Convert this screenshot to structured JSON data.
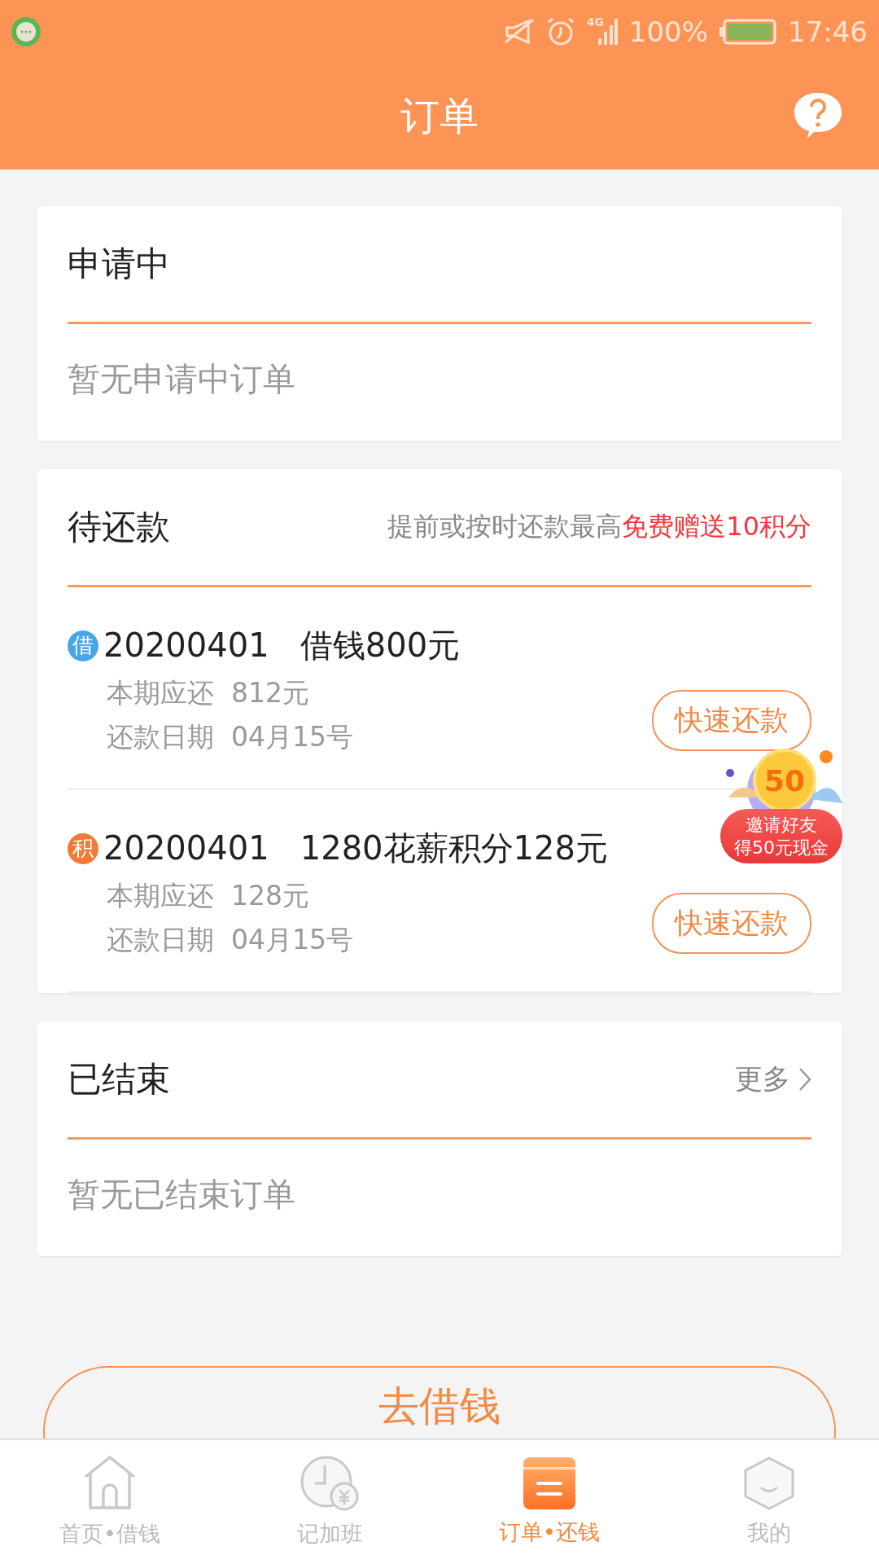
{
  "status_bar": {
    "network": "4G",
    "battery": "100%",
    "time": "17:46"
  },
  "header": {
    "title": "订单"
  },
  "sections": [
    {
      "title": "申请中",
      "empty_text": "暂无申请中订单"
    },
    {
      "title": "待还款",
      "notice": "提前或按时还款最高",
      "notice_highlight": "免费赠送10积分",
      "orders": [
        {
          "kind": "loan",
          "tag": "借",
          "id": "20200401",
          "name": "借钱800元",
          "due_label": "本期应还",
          "due": "812元",
          "date_label": "还款日期",
          "date": "04月15号",
          "button": "快速还款"
        },
        {
          "kind": "points",
          "tag": "积",
          "id": "20200401",
          "name": "1280花薪积分128元",
          "due_label": "本期应还",
          "due": "128元",
          "date_label": "还款日期",
          "date": "04月15号",
          "button": "快速还款"
        }
      ]
    },
    {
      "title": "已结束",
      "more": "更多",
      "empty_text": "暂无已结束订单"
    }
  ],
  "promo": {
    "coin": "50",
    "lines": [
      "邀请好友",
      "得50元现金"
    ]
  },
  "cta": "去借钱",
  "tabs": [
    {
      "kind": "home",
      "label": "首页•借钱",
      "selected": false
    },
    {
      "kind": "clock",
      "label": "记加班",
      "selected": false
    },
    {
      "kind": "orders",
      "label": "订单•还钱",
      "selected": true
    },
    {
      "kind": "me",
      "label": "我的",
      "selected": false
    }
  ]
}
